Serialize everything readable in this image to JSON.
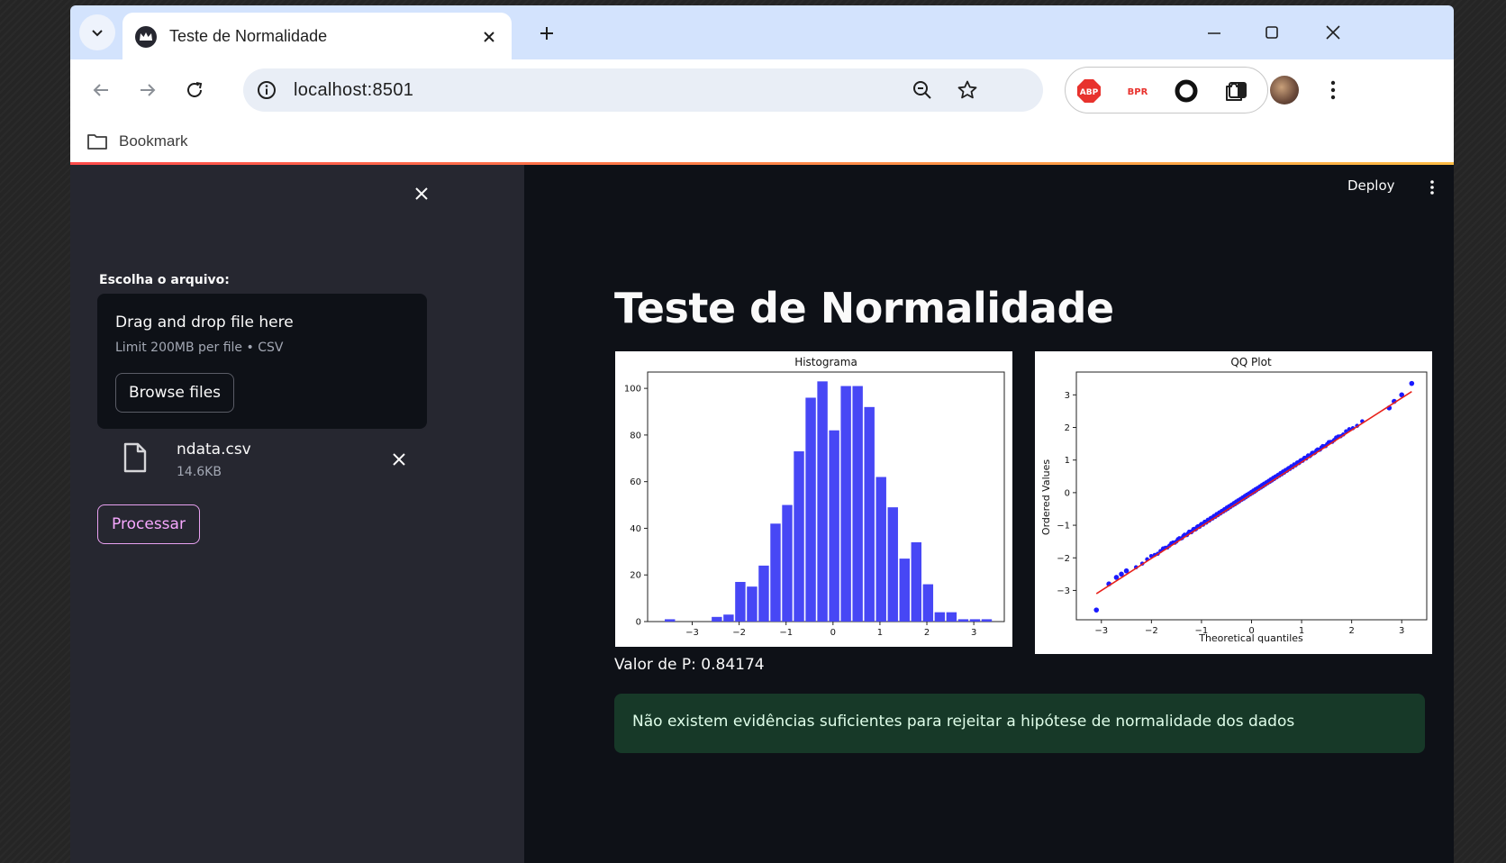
{
  "browser": {
    "tab_title": "Teste de Normalidade",
    "url": "localhost:8501",
    "bookmark_label": "Bookmark",
    "extensions": [
      "abp-icon",
      "bpr-icon",
      "circle-extension-icon",
      "puzzle-icon"
    ],
    "ext_abp_label": "ABP",
    "ext_bpr_label": "BPR"
  },
  "sidebar": {
    "uploader_label": "Escolha o arquivo:",
    "dropzone_title": "Drag and drop file here",
    "dropzone_limit": "Limit 200MB per file • CSV",
    "browse_label": "Browse files",
    "file": {
      "name": "ndata.csv",
      "size": "14.6KB"
    },
    "process_label": "Processar"
  },
  "main": {
    "deploy_label": "Deploy",
    "title": "Teste de Normalidade",
    "pvalue_text": "Valor de P: 0.84174",
    "alert_text": "Não existem evidências suficientes para rejeitar a hipótese de normalidade dos dados",
    "alert_color": "#173928"
  },
  "chart_data": [
    {
      "type": "bar",
      "title": "Histograma",
      "xlabel": "",
      "ylabel": "",
      "xticks": [
        "−3",
        "−2",
        "−1",
        "0",
        "1",
        "2",
        "3"
      ],
      "yticks": [
        "0",
        "20",
        "40",
        "60",
        "80",
        "100"
      ],
      "xlim": [
        -3.95,
        3.65
      ],
      "ylim": [
        0,
        107
      ],
      "bin_width": 0.25,
      "bin_start": -3.6,
      "values": [
        1,
        0,
        0,
        0,
        2,
        3,
        17,
        15,
        24,
        42,
        50,
        73,
        96,
        103,
        82,
        101,
        101,
        92,
        62,
        49,
        27,
        34,
        16,
        4,
        4,
        1,
        1,
        1
      ],
      "color": "#4747f5",
      "grid": false
    },
    {
      "type": "scatter",
      "title": "QQ Plot",
      "xlabel": "Theoretical quantiles",
      "ylabel": "Ordered Values",
      "xticks": [
        "−3",
        "−2",
        "−1",
        "0",
        "1",
        "2",
        "3"
      ],
      "yticks": [
        "−3",
        "−2",
        "−1",
        "0",
        "1",
        "2",
        "3"
      ],
      "xlim": [
        -3.5,
        3.5
      ],
      "ylim": [
        -3.9,
        3.7
      ],
      "fit_line": {
        "x": [
          -3.1,
          3.2
        ],
        "y": [
          -3.1,
          3.1
        ],
        "color": "#e8221b"
      },
      "points_color": "#1a1aff",
      "n_points": 1000,
      "low_tail": [
        [
          -3.1,
          -3.6
        ],
        [
          -2.85,
          -2.8
        ],
        [
          -2.7,
          -2.6
        ],
        [
          -2.6,
          -2.5
        ],
        [
          -2.5,
          -2.4
        ]
      ],
      "high_tail": [
        [
          2.75,
          2.6
        ],
        [
          2.85,
          2.8
        ],
        [
          3.0,
          3.0
        ],
        [
          3.2,
          3.35
        ]
      ],
      "grid": false
    }
  ]
}
